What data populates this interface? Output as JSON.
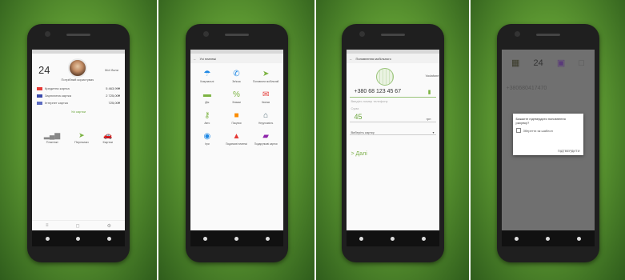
{
  "screen1": {
    "date": "24",
    "user_name": "Потрібний користувач",
    "side_label": "Мої бали",
    "cards": [
      {
        "name": "Кредитна картка",
        "amount": "5 463,99₴",
        "color": "#e53935"
      },
      {
        "name": "Зарплатна картка",
        "amount": "2 725,00₴",
        "color": "#3949ab"
      },
      {
        "name": "Інтернет картка",
        "amount": "725,00₴",
        "color": "#5c6bc0"
      }
    ],
    "more_link": "Усі картки",
    "actions": [
      {
        "label": "Платежі",
        "icon": "signal-bars-icon",
        "glyph": "▂▄▆",
        "color": "#888888"
      },
      {
        "label": "Перекази",
        "icon": "transfer-arrow-icon",
        "glyph": "➤",
        "color": "#7cb342"
      },
      {
        "label": "Картки",
        "icon": "car-icon",
        "glyph": "🚗",
        "color": "#e53935"
      }
    ],
    "bottom_nav": [
      "≡",
      "◻",
      "⚙"
    ]
  },
  "screen2": {
    "title": "Усі платежі",
    "items": [
      {
        "label": "Комунальні",
        "icon": "umbrella-icon",
        "glyph": "☂",
        "color": "#1e88e5"
      },
      {
        "label": "Зв'язок",
        "icon": "phone-icon",
        "glyph": "✆",
        "color": "#1e88e5"
      },
      {
        "label": "Поповнити мобільний",
        "icon": "arrow-icon",
        "glyph": "➤",
        "color": "#7cb342"
      },
      {
        "label": "Дім",
        "icon": "house-icon",
        "glyph": "▬",
        "color": "#7cb342"
      },
      {
        "label": "Знижки",
        "icon": "percent-icon",
        "glyph": "%",
        "color": "#7cb342"
      },
      {
        "label": "Квитки",
        "icon": "ticket-icon",
        "glyph": "✉",
        "color": "#e53935"
      },
      {
        "label": "Авто",
        "icon": "key-icon",
        "glyph": "⚷",
        "color": "#7cb342"
      },
      {
        "label": "Покупки",
        "icon": "bag-icon",
        "glyph": "■",
        "color": "#fb8c00"
      },
      {
        "label": "Нерухомість",
        "icon": "home-icon",
        "glyph": "⌂",
        "color": "#546e7a"
      },
      {
        "label": "Ігри",
        "icon": "target-icon",
        "glyph": "◉",
        "color": "#1e88e5"
      },
      {
        "label": "Податкові платежі",
        "icon": "bank-icon",
        "glyph": "▲",
        "color": "#e53935"
      },
      {
        "label": "Подарункові картки",
        "icon": "folder-icon",
        "glyph": "▰",
        "color": "#8e24aa"
      }
    ]
  },
  "screen3": {
    "title": "Поповнення мобільного",
    "operator": "Vodafone",
    "phone": "+380 68 123 45 67",
    "hint": "Введіть номер телефону",
    "amount_label": "Сума",
    "amount": "45",
    "currency": "грн",
    "select_label": "Виберіть картку",
    "next": "> Далі"
  },
  "screen4": {
    "date": "24",
    "phone": "+380680417470",
    "dialog_text": "Бажаєте підтвердити поповнення рахунку?",
    "dialog_option": "Зберегти як шаблон",
    "dialog_ok": "ПІДТВЕРДИТИ"
  }
}
